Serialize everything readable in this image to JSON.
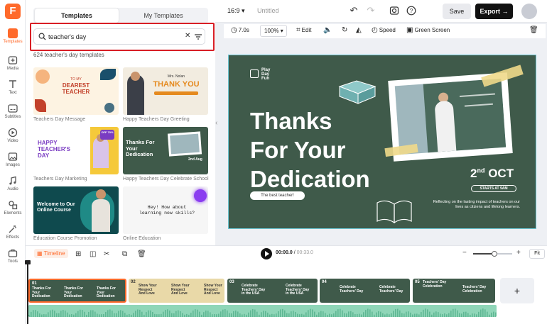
{
  "app": {
    "logo_letter": "F",
    "doc_title": "Untitled",
    "aspect_ratio": "16:9",
    "accent_color": "#ff6a2b"
  },
  "rail": {
    "items": [
      {
        "label": "Templates",
        "icon": "templates-icon",
        "active": true
      },
      {
        "label": "Media",
        "icon": "media-icon"
      },
      {
        "label": "Text",
        "icon": "text-icon"
      },
      {
        "label": "Subtitles",
        "icon": "subtitles-icon"
      },
      {
        "label": "Video",
        "icon": "video-icon"
      },
      {
        "label": "Images",
        "icon": "images-icon"
      },
      {
        "label": "Audio",
        "icon": "audio-icon"
      },
      {
        "label": "Elements",
        "icon": "elements-icon"
      },
      {
        "label": "Effects",
        "icon": "effects-icon"
      },
      {
        "label": "Tools",
        "icon": "tools-icon"
      }
    ]
  },
  "panel": {
    "tabs": [
      "Templates",
      "My Templates"
    ],
    "search_value": "teacher's day",
    "result_count": "624 teacher's day templates",
    "templates": [
      {
        "label": "Teachers Day Message",
        "thumb": {
          "top": "TO MY",
          "main": "DEAREST TEACHER"
        }
      },
      {
        "label": "Happy Teachers Day Greeting",
        "thumb": {
          "top": "Mrs. Nolan",
          "main": "THANK YOU"
        }
      },
      {
        "label": "Teachers Day Marketing",
        "thumb": {
          "main": "HAPPY TEACHER'S DAY",
          "badge": "OFF 70%"
        }
      },
      {
        "label": "Happy Teachers Day Celebrate School",
        "thumb": {
          "main": "Thanks For Your Dedication",
          "date": "2nd Aug"
        }
      },
      {
        "label": "Education Course Promotion",
        "thumb": {
          "main": "Welcome to Our Online Course"
        }
      },
      {
        "label": "Online Education",
        "thumb": {
          "main": "Hey! How about learning new skills?"
        }
      }
    ]
  },
  "topbar": {
    "save_label": "Save",
    "export_label": "Export"
  },
  "toolbar": {
    "duration": "7.0s",
    "zoom": "100%",
    "edit": "Edit",
    "speed": "Speed",
    "green_screen": "Green Screen"
  },
  "canvas": {
    "brand": [
      "Play",
      "Day",
      "Fun"
    ],
    "title_lines": [
      "Thanks",
      "For Your",
      "Dedication"
    ],
    "pill": "The best teacher!",
    "date_num": "2",
    "date_sup": "nd",
    "date_rest": " OCT",
    "starts": "STARTS AT 9AM",
    "reflect": "Reflecting on the lasting impact of teachers on our lives as citizens and lifelong learners.",
    "bg_color": "#3f5a4a"
  },
  "timeline": {
    "label": "Timeline",
    "current_time": "00:00.0",
    "total_time": "00:33.0",
    "fit_label": "Fit",
    "zoom_fraction": 0.55,
    "clips": [
      {
        "num": "01",
        "text": "Thanks For Your Dedication"
      },
      {
        "num": "02",
        "text": "Show Your Respect And Love"
      },
      {
        "num": "03",
        "text": "Celebrate Teachers' Day in the USA"
      },
      {
        "num": "04",
        "text": "Celebrate Teachers' Day"
      },
      {
        "num": "05",
        "text": "Teachers' Day Celebration"
      }
    ]
  }
}
